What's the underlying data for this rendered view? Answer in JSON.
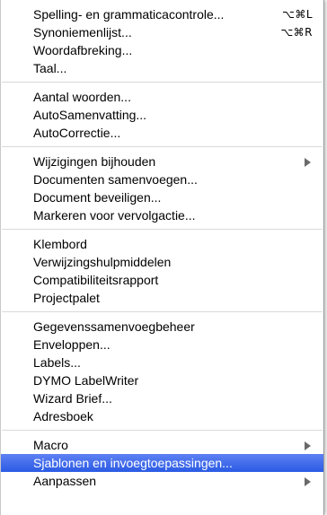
{
  "menu": {
    "group1": [
      {
        "label": "Spelling- en grammaticacontrole...",
        "shortcut": "⌥⌘L"
      },
      {
        "label": "Synoniemenlijst...",
        "shortcut": "⌥⌘R"
      },
      {
        "label": "Woordafbreking..."
      },
      {
        "label": "Taal..."
      }
    ],
    "group2": [
      {
        "label": "Aantal woorden..."
      },
      {
        "label": "AutoSamenvatting..."
      },
      {
        "label": "AutoCorrectie..."
      }
    ],
    "group3": [
      {
        "label": "Wijzigingen bijhouden"
      },
      {
        "label": "Documenten samenvoegen..."
      },
      {
        "label": "Document beveiligen..."
      },
      {
        "label": "Markeren voor vervolgactie..."
      }
    ],
    "group4": [
      {
        "label": "Klembord"
      },
      {
        "label": "Verwijzingshulpmiddelen"
      },
      {
        "label": "Compatibiliteitsrapport"
      },
      {
        "label": "Projectpalet"
      }
    ],
    "group5": [
      {
        "label": "Gegevenssamenvoegbeheer"
      },
      {
        "label": "Enveloppen..."
      },
      {
        "label": "Labels..."
      },
      {
        "label": "DYMO LabelWriter"
      },
      {
        "label": "Wizard Brief..."
      },
      {
        "label": "Adresboek"
      }
    ],
    "group6": [
      {
        "label": "Macro"
      },
      {
        "label": "Sjablonen en invoegtoepassingen..."
      },
      {
        "label": "Aanpassen"
      }
    ]
  },
  "colors": {
    "highlight": "#3a6ae8",
    "separator": "#d9d9d9"
  }
}
